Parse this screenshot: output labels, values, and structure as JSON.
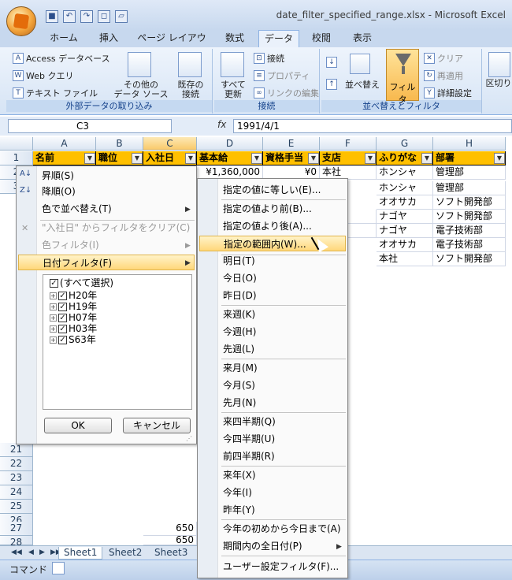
{
  "window": {
    "title": "date_filter_specified_range.xlsx - Microsoft Excel"
  },
  "tabs": [
    {
      "label": "ホーム"
    },
    {
      "label": "挿入"
    },
    {
      "label": "ページ レイアウト"
    },
    {
      "label": "数式"
    },
    {
      "label": "データ"
    },
    {
      "label": "校閲"
    },
    {
      "label": "表示"
    }
  ],
  "ribbon": {
    "external": {
      "label": "外部データの取り込み",
      "access": "Access データベース",
      "web": "Web クエリ",
      "text": "テキスト ファイル",
      "other_line1": "その他の",
      "other_line2": "データ ソース",
      "existing_line1": "既存の",
      "existing_line2": "接続"
    },
    "connections": {
      "label": "接続",
      "refresh_line1": "すべて",
      "refresh_line2": "更新",
      "conn": "接続",
      "props": "プロパティ",
      "links": "リンクの編集"
    },
    "sort": {
      "label": "並べ替えとフィルタ",
      "sort": "並べ替え",
      "filter": "フィルタ",
      "clear": "クリア",
      "reapply": "再適用",
      "advanced": "詳細設定",
      "cut": "区切り"
    }
  },
  "formula_bar": {
    "name_box": "C3",
    "fx": "fx",
    "value": "1991/4/1"
  },
  "columns": [
    "A",
    "B",
    "C",
    "D",
    "E",
    "F",
    "G",
    "H"
  ],
  "header_row": [
    "名前",
    "職位",
    "入社日",
    "基本給",
    "資格手当",
    "支店",
    "ふりがな",
    "部署"
  ],
  "rows": [
    {
      "num": "1"
    },
    {
      "num": "2",
      "d": "¥1,360,000",
      "e": "¥0",
      "f": "本社",
      "g": "ホンシャ",
      "h": "管理部"
    },
    {
      "num": "3",
      "g": "ホンシャ",
      "h": "管理部"
    },
    {
      "num": "4",
      "g": "オオサカ",
      "h": "ソフト開発部"
    },
    {
      "num": "5",
      "f": "屋",
      "g": "ナゴヤ",
      "h": "ソフト開発部"
    },
    {
      "num": "6",
      "f": "屋",
      "g": "ナゴヤ",
      "h": "電子技術部"
    },
    {
      "num": "7",
      "g": "オオサカ",
      "h": "電子技術部"
    },
    {
      "num": "8",
      "g": "本社",
      "h": "ソフト開発部"
    }
  ],
  "bottom_rows": [
    {
      "num": "21"
    },
    {
      "num": "22"
    },
    {
      "num": "23"
    },
    {
      "num": "24"
    },
    {
      "num": "25"
    },
    {
      "num": "26"
    },
    {
      "num": "27",
      "c": "650"
    },
    {
      "num": "28",
      "c": "650"
    }
  ],
  "filter_menu": {
    "sort_asc": "昇順(S)",
    "sort_desc": "降順(O)",
    "sort_color": "色で並べ替え(T)",
    "clear": "\"入社日\" からフィルタをクリア(C)",
    "color_filter": "色フィルタ(I)",
    "date_filter": "日付フィルタ(F)",
    "tree": [
      "(すべて選択)",
      "H20年",
      "H19年",
      "H07年",
      "H03年",
      "S63年"
    ],
    "ok": "OK",
    "cancel": "キャンセル"
  },
  "date_submenu": {
    "items": [
      "指定の値に等しい(E)...",
      "指定の値より前(B)...",
      "指定の値より後(A)...",
      "指定の範囲内(W)...",
      "明日(T)",
      "今日(O)",
      "昨日(D)",
      "来週(K)",
      "今週(H)",
      "先週(L)",
      "来月(M)",
      "今月(S)",
      "先月(N)",
      "来四半期(Q)",
      "今四半期(U)",
      "前四半期(R)",
      "来年(X)",
      "今年(I)",
      "昨年(Y)",
      "今年の初めから今日まで(A)",
      "期間内の全日付(P)",
      "ユーザー設定フィルタ(F)..."
    ]
  },
  "sheets": [
    "Sheet1",
    "Sheet2",
    "Sheet3"
  ],
  "status": {
    "mode": "コマンド"
  },
  "colors": {
    "header_fill": "#ffc000",
    "menu_highlight": "#ffd77a",
    "ribbon_bg": "#d6e4f5"
  },
  "icons": [
    "office-button",
    "save-icon",
    "undo-icon",
    "redo-icon",
    "funnel-icon",
    "sort-icon",
    "checkbox-icon",
    "arrow-right-icon",
    "mouse-cursor-icon"
  ]
}
